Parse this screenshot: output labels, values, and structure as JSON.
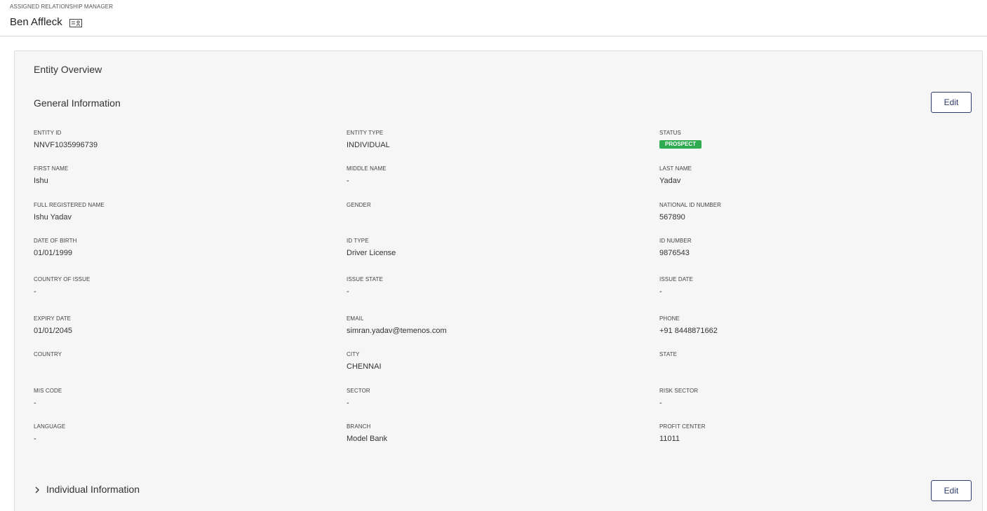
{
  "header": {
    "rm_label": "ASSIGNED RELATIONSHIP MANAGER",
    "rm_name": "Ben Affleck",
    "rm_icon": "contact-card-icon"
  },
  "panel": {
    "title": "Entity Overview",
    "general_section_title": "General Information",
    "edit_label": "Edit",
    "individual_section_title": "Individual Information",
    "individual_edit_label": "Edit"
  },
  "fields": [
    {
      "label": "ENTITY ID",
      "value": "NNVF1035996739"
    },
    {
      "label": "ENTITY TYPE",
      "value": "INDIVIDUAL"
    },
    {
      "label": "STATUS",
      "value": "PROSPECT"
    },
    {
      "label": "FIRST NAME",
      "value": "Ishu"
    },
    {
      "label": "MIDDLE NAME",
      "value": "-"
    },
    {
      "label": "LAST NAME",
      "value": "Yadav"
    },
    {
      "label": "FULL REGISTERED NAME",
      "value": "Ishu Yadav"
    },
    {
      "label": "GENDER",
      "value": ""
    },
    {
      "label": "NATIONAL ID NUMBER",
      "value": "567890"
    },
    {
      "label": "DATE OF BIRTH",
      "value": "01/01/1999"
    },
    {
      "label": "ID TYPE",
      "value": "Driver License"
    },
    {
      "label": "ID NUMBER",
      "value": "9876543"
    },
    {
      "label": "COUNTRY OF ISSUE",
      "value": "-"
    },
    {
      "label": "ISSUE STATE",
      "value": "-"
    },
    {
      "label": "ISSUE DATE",
      "value": "-"
    },
    {
      "label": "EXPIRY DATE",
      "value": "01/01/2045"
    },
    {
      "label": "EMAIL",
      "value": "simran.yadav@temenos.com"
    },
    {
      "label": "PHONE",
      "value": "+91 8448871662"
    },
    {
      "label": "COUNTRY",
      "value": ""
    },
    {
      "label": "CITY",
      "value": "CHENNAI"
    },
    {
      "label": "STATE",
      "value": ""
    },
    {
      "label": "MIS CODE",
      "value": "-"
    },
    {
      "label": "SECTOR",
      "value": "-"
    },
    {
      "label": "RISK SECTOR",
      "value": "-"
    },
    {
      "label": "LANGUAGE",
      "value": "-"
    },
    {
      "label": "BRANCH",
      "value": "Model Bank"
    },
    {
      "label": "PROFIT CENTER",
      "value": "11011"
    }
  ],
  "colors": {
    "status_badge": "#2eaa4f",
    "edit_button_border": "#2d3a6a",
    "panel_background": "#f6f6f6"
  }
}
